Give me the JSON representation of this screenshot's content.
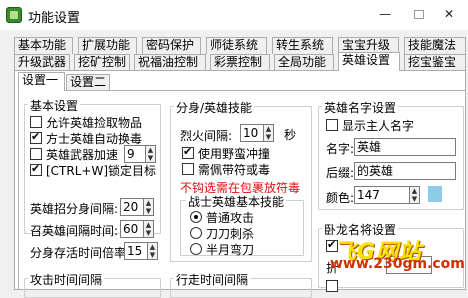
{
  "window": {
    "title": "功能设置",
    "min": "—",
    "close": "✕"
  },
  "tabs_row1": [
    "基本功能",
    "扩展功能",
    "密码保护",
    "师徒系统",
    "转生系统",
    "宝宝升级",
    "技能魔法"
  ],
  "tabs_row2": [
    "升级武器",
    "挖矿控制",
    "祝福油控制",
    "彩票控制",
    "全局功能",
    "英雄设置",
    "挖宝鉴宝"
  ],
  "subtabs": [
    "设置一",
    "设置二"
  ],
  "basic": {
    "title": "基本设置",
    "allow_pickup": "允许英雄捡取物品",
    "auto_poison": "方士英雄自动换毒",
    "weapon_boost": "英雄武器加速",
    "weapon_boost_value": "9",
    "lock_target": "[CTRL+W]锁定目标",
    "summon_interval_label": "英雄招分身间隔:",
    "summon_interval_value": "20",
    "recall_interval_label": "召英雄间隔时间:",
    "recall_interval_value": "60",
    "clone_duration_label": "分身存活时间倍率:",
    "clone_duration_value": "15"
  },
  "clone_skill": {
    "title": "分身/英雄技能",
    "fire_interval_label": "烈火间隔:",
    "fire_interval_value": "10",
    "fire_interval_unit": "秒",
    "use_wild_charge": "使用野蛮冲撞",
    "need_amulet": "需佩带符或毒",
    "warning": "不钩选需在包裹放符毒"
  },
  "warrior_skill": {
    "title": "战士英雄基本技能",
    "options": [
      "普通攻击",
      "刀刀刺杀",
      "半月弯刀"
    ]
  },
  "hero_name": {
    "title": "英雄名字设置",
    "show_master": "显示主人名字",
    "name_label": "名字:",
    "name_value": "英雄",
    "suffix_label": "后缀:",
    "suffix_value": "的英雄",
    "color_label": "颜色:",
    "color_value": "147",
    "swatch_color": "#8ecbe9"
  },
  "dragon": {
    "title": "卧龙名将设置",
    "partial_label": "折"
  },
  "bottom": {
    "attack_interval": "攻击时间间隔",
    "walk_interval": "行走时间间隔"
  },
  "watermark": {
    "text": "飞G网站",
    "url": "www.230gm.com"
  }
}
